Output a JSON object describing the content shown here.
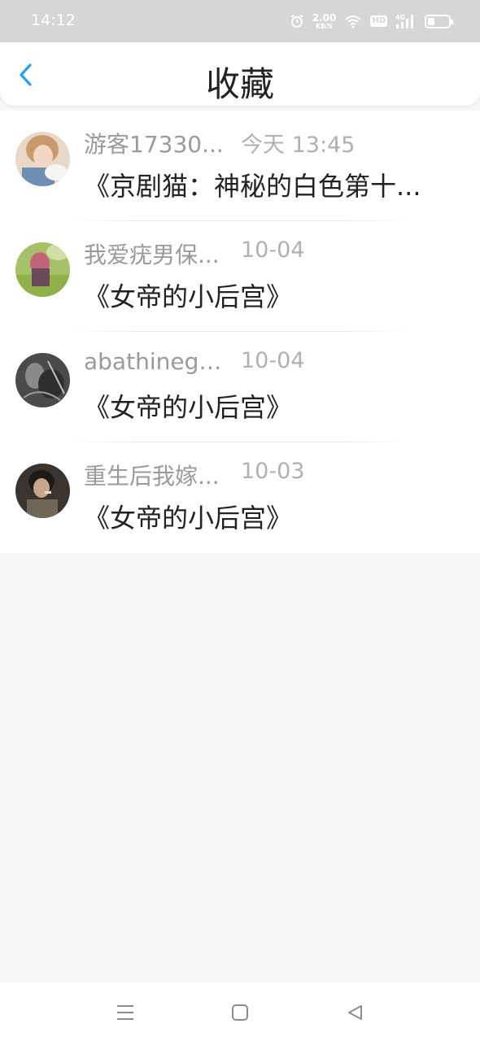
{
  "status_bar": {
    "time": "14:12",
    "net_speed_value": "2.00",
    "net_speed_unit": "KB/S",
    "hd_badge": "HD",
    "signal_label": "4G",
    "icons": [
      "alarm-icon",
      "wifi-icon",
      "hd-icon",
      "signal-4g-icon",
      "battery-icon"
    ]
  },
  "header": {
    "title": "收藏",
    "back_icon": "chevron-left-icon",
    "accent_color": "#2a9df4"
  },
  "favorites": [
    {
      "name": "游客17330...",
      "time": "今天 13:45",
      "title": "《京剧猫：神秘的白色第十..."
    },
    {
      "name": "我爱疣男保...",
      "time": "10-04",
      "title": "《女帝的小后宫》"
    },
    {
      "name": "abathinega...",
      "time": "10-04",
      "title": "《女帝的小后宫》"
    },
    {
      "name": "重生后我嫁...",
      "time": "10-03",
      "title": "《女帝的小后宫》"
    }
  ],
  "nav_bar": {
    "icons": [
      "menu-icon",
      "home-square-icon",
      "back-triangle-icon"
    ]
  }
}
